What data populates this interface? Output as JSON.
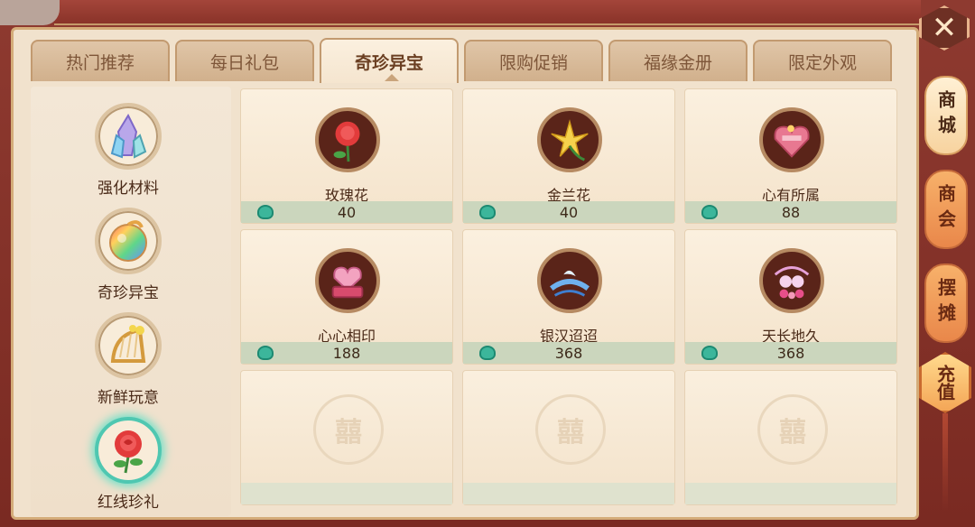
{
  "tabs": [
    {
      "label": "热门推荐"
    },
    {
      "label": "每日礼包"
    },
    {
      "label": "奇珍异宝"
    },
    {
      "label": "限购促销"
    },
    {
      "label": "福缘金册"
    },
    {
      "label": "限定外观"
    }
  ],
  "active_tab": "奇珍异宝",
  "categories": [
    {
      "label": "强化材料",
      "icon": "crystal-icon"
    },
    {
      "label": "奇珍异宝",
      "icon": "rainbow-orb-icon"
    },
    {
      "label": "新鲜玩意",
      "icon": "harp-icon"
    },
    {
      "label": "红线珍礼",
      "icon": "rose-icon"
    }
  ],
  "selected_category": "红线珍礼",
  "items": [
    {
      "name": "玫瑰花",
      "price": "40",
      "icon": "rose-icon"
    },
    {
      "name": "金兰花",
      "price": "40",
      "icon": "lily-icon"
    },
    {
      "name": "心有所属",
      "price": "88",
      "icon": "heart-box-icon"
    },
    {
      "name": "心心相印",
      "price": "188",
      "icon": "heart-chest-icon"
    },
    {
      "name": "银汉迢迢",
      "price": "368",
      "icon": "bird-bridge-icon"
    },
    {
      "name": "天长地久",
      "price": "368",
      "icon": "lovebirds-icon"
    }
  ],
  "empty_slot_mark": "囍",
  "side_nav": [
    {
      "label": "商城",
      "active": true
    },
    {
      "label": "商会",
      "active": false
    },
    {
      "label": "摆摊",
      "active": false
    }
  ],
  "recharge_label": "充值",
  "close_label": "✕",
  "currency_icon": "jade-icon",
  "colors": {
    "frame": "#7a2a22",
    "panel": "#f1e2cd",
    "price_bar": "#cbd6bd",
    "selected_glow": "#4fc7b1"
  }
}
